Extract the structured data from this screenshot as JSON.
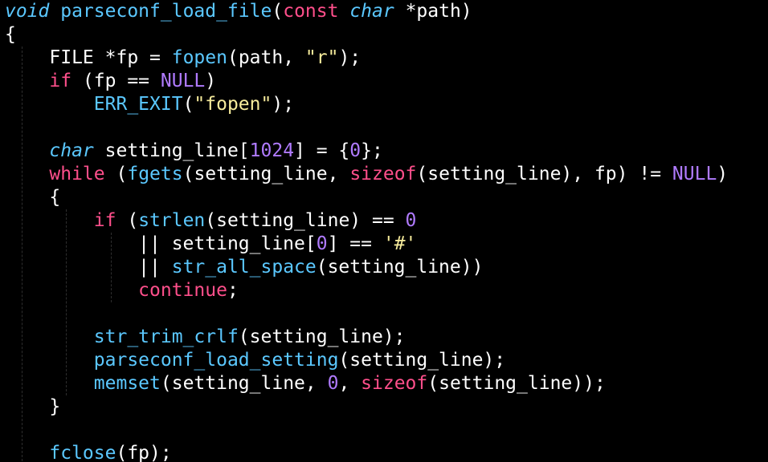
{
  "colors": {
    "background": "#000000",
    "plain": "#ffffff",
    "keyword": "#ff4f8b",
    "type": "#5bc8ff",
    "function": "#5bc8ff",
    "number": "#b07bff",
    "constant": "#b07bff",
    "string": "#f7ec9c",
    "indent_guide": "#2e2e2e"
  },
  "code_lines": [
    [
      {
        "t": "void",
        "c": "type",
        "i": true
      },
      {
        "t": " ",
        "c": "plain"
      },
      {
        "t": "parseconf_load_file",
        "c": "function"
      },
      {
        "t": "(",
        "c": "plain"
      },
      {
        "t": "const",
        "c": "keyword"
      },
      {
        "t": " ",
        "c": "plain"
      },
      {
        "t": "char",
        "c": "type",
        "i": true
      },
      {
        "t": " *path)",
        "c": "plain"
      }
    ],
    [
      {
        "t": "{",
        "c": "plain"
      }
    ],
    [
      {
        "t": "    FILE *fp = ",
        "c": "plain"
      },
      {
        "t": "fopen",
        "c": "function"
      },
      {
        "t": "(path, ",
        "c": "plain"
      },
      {
        "t": "\"r\"",
        "c": "string"
      },
      {
        "t": ");",
        "c": "plain"
      }
    ],
    [
      {
        "t": "    ",
        "c": "plain"
      },
      {
        "t": "if",
        "c": "keyword"
      },
      {
        "t": " (fp == ",
        "c": "plain"
      },
      {
        "t": "NULL",
        "c": "constant"
      },
      {
        "t": ")",
        "c": "plain"
      }
    ],
    [
      {
        "t": "        ",
        "c": "plain"
      },
      {
        "t": "ERR_EXIT",
        "c": "function"
      },
      {
        "t": "(",
        "c": "plain"
      },
      {
        "t": "\"fopen\"",
        "c": "string"
      },
      {
        "t": ");",
        "c": "plain"
      }
    ],
    [],
    [
      {
        "t": "    ",
        "c": "plain"
      },
      {
        "t": "char",
        "c": "type",
        "i": true
      },
      {
        "t": " setting_line[",
        "c": "plain"
      },
      {
        "t": "1024",
        "c": "number"
      },
      {
        "t": "] = {",
        "c": "plain"
      },
      {
        "t": "0",
        "c": "number"
      },
      {
        "t": "};",
        "c": "plain"
      }
    ],
    [
      {
        "t": "    ",
        "c": "plain"
      },
      {
        "t": "while",
        "c": "keyword"
      },
      {
        "t": " (",
        "c": "plain"
      },
      {
        "t": "fgets",
        "c": "function"
      },
      {
        "t": "(setting_line, ",
        "c": "plain"
      },
      {
        "t": "sizeof",
        "c": "keyword"
      },
      {
        "t": "(setting_line), fp) != ",
        "c": "plain"
      },
      {
        "t": "NULL",
        "c": "constant"
      },
      {
        "t": ")",
        "c": "plain"
      }
    ],
    [
      {
        "t": "    {",
        "c": "plain"
      }
    ],
    [
      {
        "t": "        ",
        "c": "plain"
      },
      {
        "t": "if",
        "c": "keyword"
      },
      {
        "t": " (",
        "c": "plain"
      },
      {
        "t": "strlen",
        "c": "function"
      },
      {
        "t": "(setting_line) == ",
        "c": "plain"
      },
      {
        "t": "0",
        "c": "number"
      }
    ],
    [
      {
        "t": "            || setting_line[",
        "c": "plain"
      },
      {
        "t": "0",
        "c": "number"
      },
      {
        "t": "] == ",
        "c": "plain"
      },
      {
        "t": "'#'",
        "c": "string"
      }
    ],
    [
      {
        "t": "            || ",
        "c": "plain"
      },
      {
        "t": "str_all_space",
        "c": "function"
      },
      {
        "t": "(setting_line))",
        "c": "plain"
      }
    ],
    [
      {
        "t": "            ",
        "c": "plain"
      },
      {
        "t": "continue",
        "c": "keyword"
      },
      {
        "t": ";",
        "c": "plain"
      }
    ],
    [],
    [
      {
        "t": "        ",
        "c": "plain"
      },
      {
        "t": "str_trim_crlf",
        "c": "function"
      },
      {
        "t": "(setting_line);",
        "c": "plain"
      }
    ],
    [
      {
        "t": "        ",
        "c": "plain"
      },
      {
        "t": "parseconf_load_setting",
        "c": "function"
      },
      {
        "t": "(setting_line);",
        "c": "plain"
      }
    ],
    [
      {
        "t": "        ",
        "c": "plain"
      },
      {
        "t": "memset",
        "c": "function"
      },
      {
        "t": "(setting_line, ",
        "c": "plain"
      },
      {
        "t": "0",
        "c": "number"
      },
      {
        "t": ", ",
        "c": "plain"
      },
      {
        "t": "sizeof",
        "c": "keyword"
      },
      {
        "t": "(setting_line));",
        "c": "plain"
      }
    ],
    [
      {
        "t": "    }",
        "c": "plain"
      }
    ],
    [],
    [
      {
        "t": "    ",
        "c": "plain"
      },
      {
        "t": "fclose",
        "c": "function"
      },
      {
        "t": "(fp);",
        "c": "plain"
      }
    ]
  ]
}
